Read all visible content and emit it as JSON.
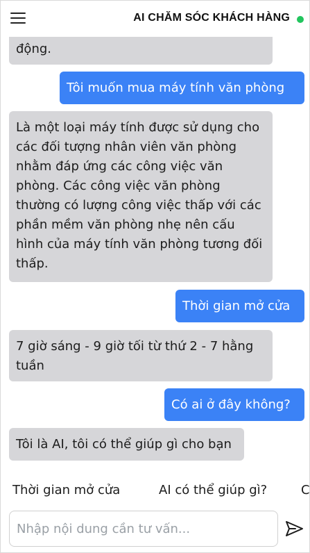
{
  "header": {
    "title": "AI CHĂM SÓC KHÁCH HÀNG"
  },
  "messages": [
    {
      "role": "bot",
      "text": "động."
    },
    {
      "role": "user",
      "text": "Tôi muốn mua máy tính văn phòng"
    },
    {
      "role": "bot",
      "text": "Là một loại máy tính được sử dụng cho các đối tượng nhân viên văn phòng nhằm đáp ứng các công việc văn phòng. Các công việc văn phòng thường có lượng công việc thấp với các phần mềm văn phòng nhẹ nên cấu hình của máy tính văn phòng tương đối thấp."
    },
    {
      "role": "user",
      "text": "Thời gian mở cửa"
    },
    {
      "role": "bot",
      "text": "7 giờ sáng - 9 giờ tối từ thứ 2 - 7 hằng tuần"
    },
    {
      "role": "user",
      "text": "Có ai ở đây không?"
    },
    {
      "role": "bot",
      "text": "Tôi là AI, tôi có thể giúp gì cho bạn"
    }
  ],
  "quick_replies": [
    "Thời gian mở cửa",
    "AI có thể giúp gì?",
    "Có ai ở đây không?"
  ],
  "input": {
    "placeholder": "Nhập nội dung cần tư vấn...",
    "value": ""
  },
  "colors": {
    "user_bubble": "#3b82f6",
    "bot_bubble": "#d6d6d9",
    "online": "#22c55e"
  }
}
